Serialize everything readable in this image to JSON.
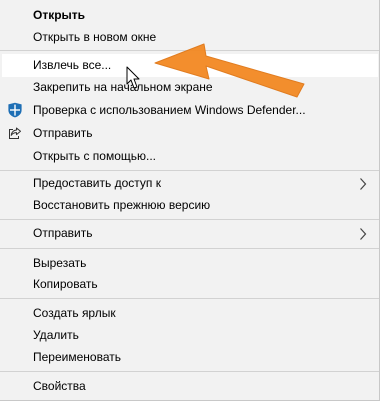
{
  "menu": {
    "items": [
      {
        "label": "Открыть"
      },
      {
        "label": "Открыть в новом окне"
      },
      {
        "label": "Извлечь все..."
      },
      {
        "label": "Закрепить на начальном экране"
      },
      {
        "label": "Проверка с использованием Windows Defender..."
      },
      {
        "label": "Отправить"
      },
      {
        "label": "Открыть с помощью..."
      },
      {
        "label": "Предоставить доступ к"
      },
      {
        "label": "Восстановить прежнюю версию"
      },
      {
        "label": "Отправить"
      },
      {
        "label": "Вырезать"
      },
      {
        "label": "Копировать"
      },
      {
        "label": "Создать ярлык"
      },
      {
        "label": "Удалить"
      },
      {
        "label": "Переименовать"
      },
      {
        "label": "Свойства"
      }
    ],
    "icons": {
      "defender": "windows-defender-shield-icon",
      "share": "share-icon",
      "submenu": "chevron-right-icon",
      "cursor": "mouse-pointer-icon",
      "annotation": "orange-arrow"
    },
    "colors": {
      "background": "#f2f2f2",
      "hover": "#ffffff",
      "separator": "#d2d2d2",
      "annotation_arrow": "#f38a25",
      "defender_blue": "#1e6fb5"
    }
  }
}
